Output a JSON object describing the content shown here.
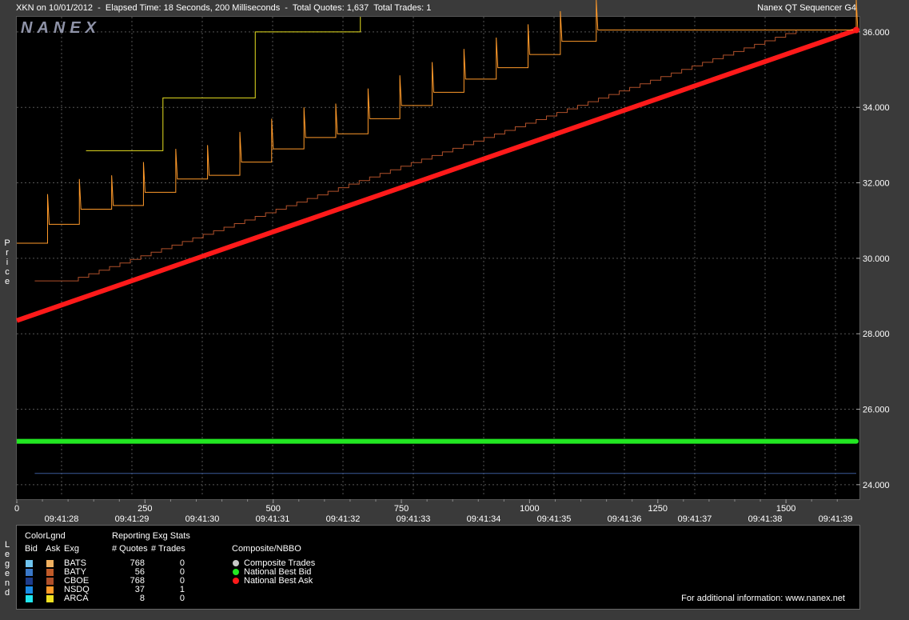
{
  "header": {
    "left_text": "XKN on 10/01/2012  -  Elapsed Time: 18 Seconds, 200 Milliseconds  -  Total Quotes: 1,637  Total Trades: 1",
    "right_text": "Nanex QT Sequencer G4"
  },
  "brand": "NANEX",
  "y_axis_label": "P r i c e",
  "legend_side_label": "L e g e n d",
  "chart_data": {
    "type": "line",
    "ylim": [
      23.7,
      36.4
    ],
    "xlim": [
      0,
      1637
    ],
    "y_ticks": [
      "36.000",
      "34.000",
      "32.000",
      "30.000",
      "28.000",
      "26.000",
      "24.000"
    ],
    "y_tick_values": [
      36,
      34,
      32,
      30,
      28,
      26,
      24
    ],
    "x_ticks": [
      "0",
      "250",
      "500",
      "750",
      "1000",
      "1250",
      "1500"
    ],
    "x_tick_values": [
      0,
      250,
      500,
      750,
      1000,
      1250,
      1500
    ],
    "time_ticks": [
      "09:41:28",
      "09:41:29",
      "09:41:30",
      "09:41:31",
      "09:41:32",
      "09:41:33",
      "09:41:34",
      "09:41:35",
      "09:41:36",
      "09:41:37",
      "09:41:38",
      "09:41:39"
    ],
    "grid": true,
    "series": [
      {
        "name": "National Best Ask",
        "color": "#ff1a1a",
        "x": [
          0,
          1637
        ],
        "y": [
          28.35,
          36.05
        ]
      },
      {
        "name": "National Best Bid",
        "color": "#22e622",
        "x": [
          0,
          1637
        ],
        "y": [
          25.15,
          25.15
        ]
      },
      {
        "name": "CBOE",
        "color": "#b0502a",
        "x": [
          35,
          120,
          1540,
          1637
        ],
        "y": [
          29.4,
          29.4,
          36.05,
          36.05
        ]
      },
      {
        "name": "NSDQ",
        "color": "#ff9a2a",
        "x": [
          0,
          60,
          122,
          185,
          247,
          310,
          372,
          435,
          497,
          560,
          622,
          685,
          747,
          810,
          872,
          935,
          997,
          1060,
          1130,
          1637
        ],
        "y": [
          30.4,
          30.9,
          31.3,
          31.4,
          31.75,
          32.1,
          32.2,
          32.55,
          32.9,
          33.2,
          33.3,
          33.7,
          34.05,
          34.4,
          34.75,
          35.05,
          35.4,
          35.75,
          36.05,
          36.05
        ]
      },
      {
        "name": "ARCA",
        "color": "#e8e020",
        "x": [
          135,
          285,
          465,
          670
        ],
        "y": [
          32.85,
          34.25,
          36.0,
          36.4
        ]
      },
      {
        "name": "BATY",
        "color": "#3a5a9a",
        "x": [
          35,
          1637
        ],
        "y": [
          24.3,
          24.3
        ]
      }
    ]
  },
  "legend": {
    "color_legend_title": "ColorLgnd",
    "bid_header": "Bid",
    "ask_header": "Ask",
    "exg_header": "Exg",
    "stats_title": "Reporting Exg Stats",
    "quotes_header": "# Quotes",
    "trades_header": "# Trades",
    "composite_title": "Composite/NBBO",
    "rows": [
      {
        "exg": "BATS",
        "quotes": "768",
        "trades": "0",
        "bid_color": "#6fc4f0",
        "ask_color": "#f0b060"
      },
      {
        "exg": "BATY",
        "quotes": "56",
        "trades": "0",
        "bid_color": "#3a78c8",
        "ask_color": "#c05a28"
      },
      {
        "exg": "CBOE",
        "quotes": "768",
        "trades": "0",
        "bid_color": "#1e3c8c",
        "ask_color": "#b0502a"
      },
      {
        "exg": "NSDQ",
        "quotes": "37",
        "trades": "1",
        "bid_color": "#1a8ce6",
        "ask_color": "#ff9a2a"
      },
      {
        "exg": "ARCA",
        "quotes": "8",
        "trades": "0",
        "bid_color": "#20e6f0",
        "ask_color": "#f0e020"
      }
    ],
    "composite_items": [
      {
        "label": "Composite Trades",
        "color": "#c8c8c8"
      },
      {
        "label": "National Best Bid",
        "color": "#22e622"
      },
      {
        "label": "National Best Ask",
        "color": "#ff1a1a"
      }
    ],
    "footer": "For additional information: www.nanex.net"
  }
}
